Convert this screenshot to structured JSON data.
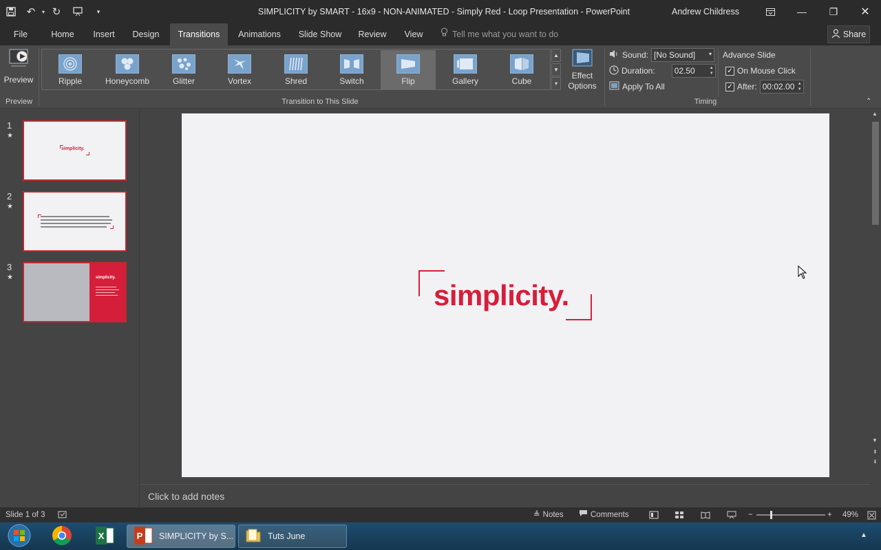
{
  "titlebar": {
    "title": "SIMPLICITY by SMART - 16x9 - NON-ANIMATED - Simply Red - Loop Presentation  -  PowerPoint",
    "user": "Andrew Childress"
  },
  "tabs": [
    "File",
    "Home",
    "Insert",
    "Design",
    "Transitions",
    "Animations",
    "Slide Show",
    "Review",
    "View"
  ],
  "active_tab": "Transitions",
  "tellme": {
    "placeholder": "Tell me what you want to do"
  },
  "share": {
    "label": "Share"
  },
  "ribbon": {
    "preview": {
      "label": "Preview",
      "group_label": "Preview"
    },
    "transitions": {
      "group_label": "Transition to This Slide",
      "items": [
        "Ripple",
        "Honeycomb",
        "Glitter",
        "Vortex",
        "Shred",
        "Switch",
        "Flip",
        "Gallery",
        "Cube"
      ],
      "selected": "Flip"
    },
    "effect_options": {
      "line1": "Effect",
      "line2": "Options"
    },
    "timing": {
      "group_label": "Timing",
      "sound_label": "Sound:",
      "sound_value": "[No Sound]",
      "duration_label": "Duration:",
      "duration_value": "02.50",
      "apply_all_label": "Apply To All",
      "advance_label": "Advance Slide",
      "on_mouse_click_label": "On Mouse Click",
      "on_mouse_click_checked": true,
      "after_label": "After:",
      "after_checked": true,
      "after_value": "00:02.00"
    }
  },
  "slides": [
    {
      "number": "1",
      "star": "★",
      "text": "simplicity."
    },
    {
      "number": "2",
      "star": "★"
    },
    {
      "number": "3",
      "star": "★",
      "text": "simplicity."
    }
  ],
  "slide_content": {
    "main_text": "simplicity."
  },
  "notes": {
    "placeholder": "Click to add notes"
  },
  "statusbar": {
    "slide_counter": "Slide 1 of 3",
    "notes_label": "Notes",
    "comments_label": "Comments",
    "zoom": "49%"
  },
  "taskbar": {
    "tasks": [
      {
        "label": "SIMPLICITY by S..."
      },
      {
        "label": "Tuts June"
      }
    ]
  },
  "colors": {
    "accent_red": "#d51f3a",
    "ribbon_bg": "#4a4a4a",
    "titlebar_bg": "#2b2b2b"
  }
}
